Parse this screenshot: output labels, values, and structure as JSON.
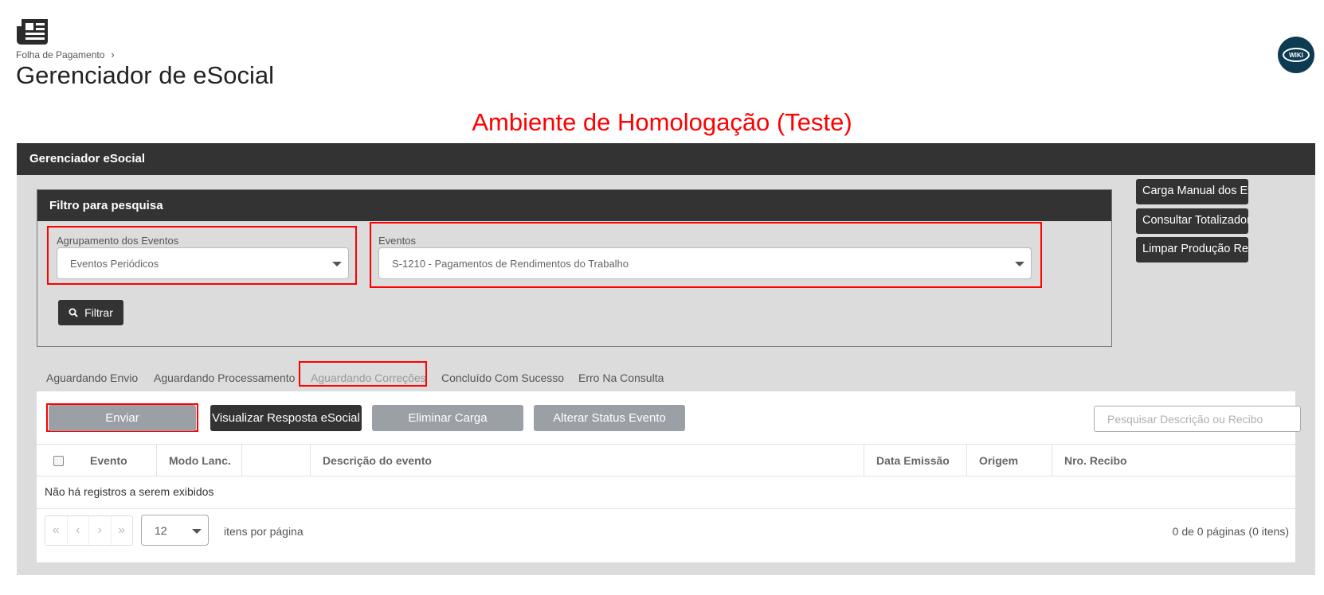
{
  "header": {
    "breadcrumb": "Folha de Pagamento",
    "breadcrumb_separator": "›",
    "title": "Gerenciador de eSocial",
    "wiki_label": "WIKI"
  },
  "environment_banner": "Ambiente de Homologação (Teste)",
  "panel": {
    "title": "Gerenciador eSocial"
  },
  "filter": {
    "title": "Filtro para pesquisa",
    "grouping_label": "Agrupamento dos Eventos",
    "grouping_value": "Eventos Periódicos",
    "events_label": "Eventos",
    "events_value": "S-1210 - Pagamentos de Rendimentos do Trabalho",
    "filter_button": "Filtrar"
  },
  "side_buttons": [
    "Carga Manual dos Eventos",
    "Consultar Totalizadores Base",
    "Limpar Produção Restrita"
  ],
  "tabs": [
    "Aguardando Envio",
    "Aguardando Processamento",
    "Aguardando Correções",
    "Concluído Com Sucesso",
    "Erro Na Consulta"
  ],
  "actions": {
    "send": "Enviar",
    "view_response": "Visualizar Resposta eSocial",
    "delete_load": "Eliminar Carga",
    "change_status": "Alterar Status Evento",
    "search_placeholder": "Pesquisar Descrição ou Recibo"
  },
  "grid": {
    "columns": [
      "Evento",
      "Modo Lanc.",
      "",
      "Descrição do evento",
      "Data Emissão",
      "Origem",
      "Nro. Recibo"
    ],
    "empty_message": "Não há registros a serem exibidos"
  },
  "pager": {
    "first": "«",
    "prev": "‹",
    "next": "›",
    "last": "»",
    "page_size": "12",
    "per_page_label": "itens por página",
    "info": "0 de 0 páginas (0 itens)"
  },
  "colors": {
    "highlight": "#ff0000",
    "dark": "#333333",
    "gray_button": "#9aa0a6",
    "panel_bg": "#dcdcdc",
    "wiki_bg": "#0d3b52"
  }
}
